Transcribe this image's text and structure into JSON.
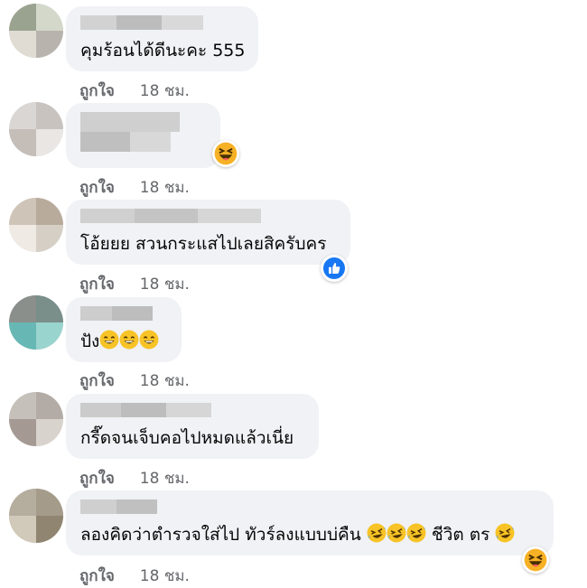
{
  "comments": [
    {
      "text": "คุมร้อนได้ดีนะคะ 555",
      "like_label": "ถูกใจ",
      "time": "18 ชม."
    },
    {
      "text": "",
      "like_label": "ถูกใจ",
      "time": "18 ชม.",
      "reaction": "haha-icon"
    },
    {
      "text": "โอ้ยยย สวนกระแสไปเลยสิครับคร",
      "like_label": "ถูกใจ",
      "time": "18 ชม.",
      "reaction": "like-icon"
    },
    {
      "text": "ปัง",
      "like_label": "ถูกใจ",
      "time": "18 ชม."
    },
    {
      "text": "กรี๊ดจนเจ็บคอไปหมดแล้วเนี่ย",
      "like_label": "ถูกใจ",
      "time": "18 ชม."
    },
    {
      "text_a": "ลองคิดว่าตำรวจใส่ไป ทัวร์ลงแบบบ่คืน",
      "text_b": "ชีวิต ตร",
      "like_label": "ถูกใจ",
      "time": "18 ชม.",
      "reaction": "haha-icon"
    }
  ],
  "colors": {
    "bubble": "#f0f2f5",
    "meta_text": "#65676b",
    "like_blue": "#1877f2",
    "emoji_yellow": "#f7b125"
  }
}
